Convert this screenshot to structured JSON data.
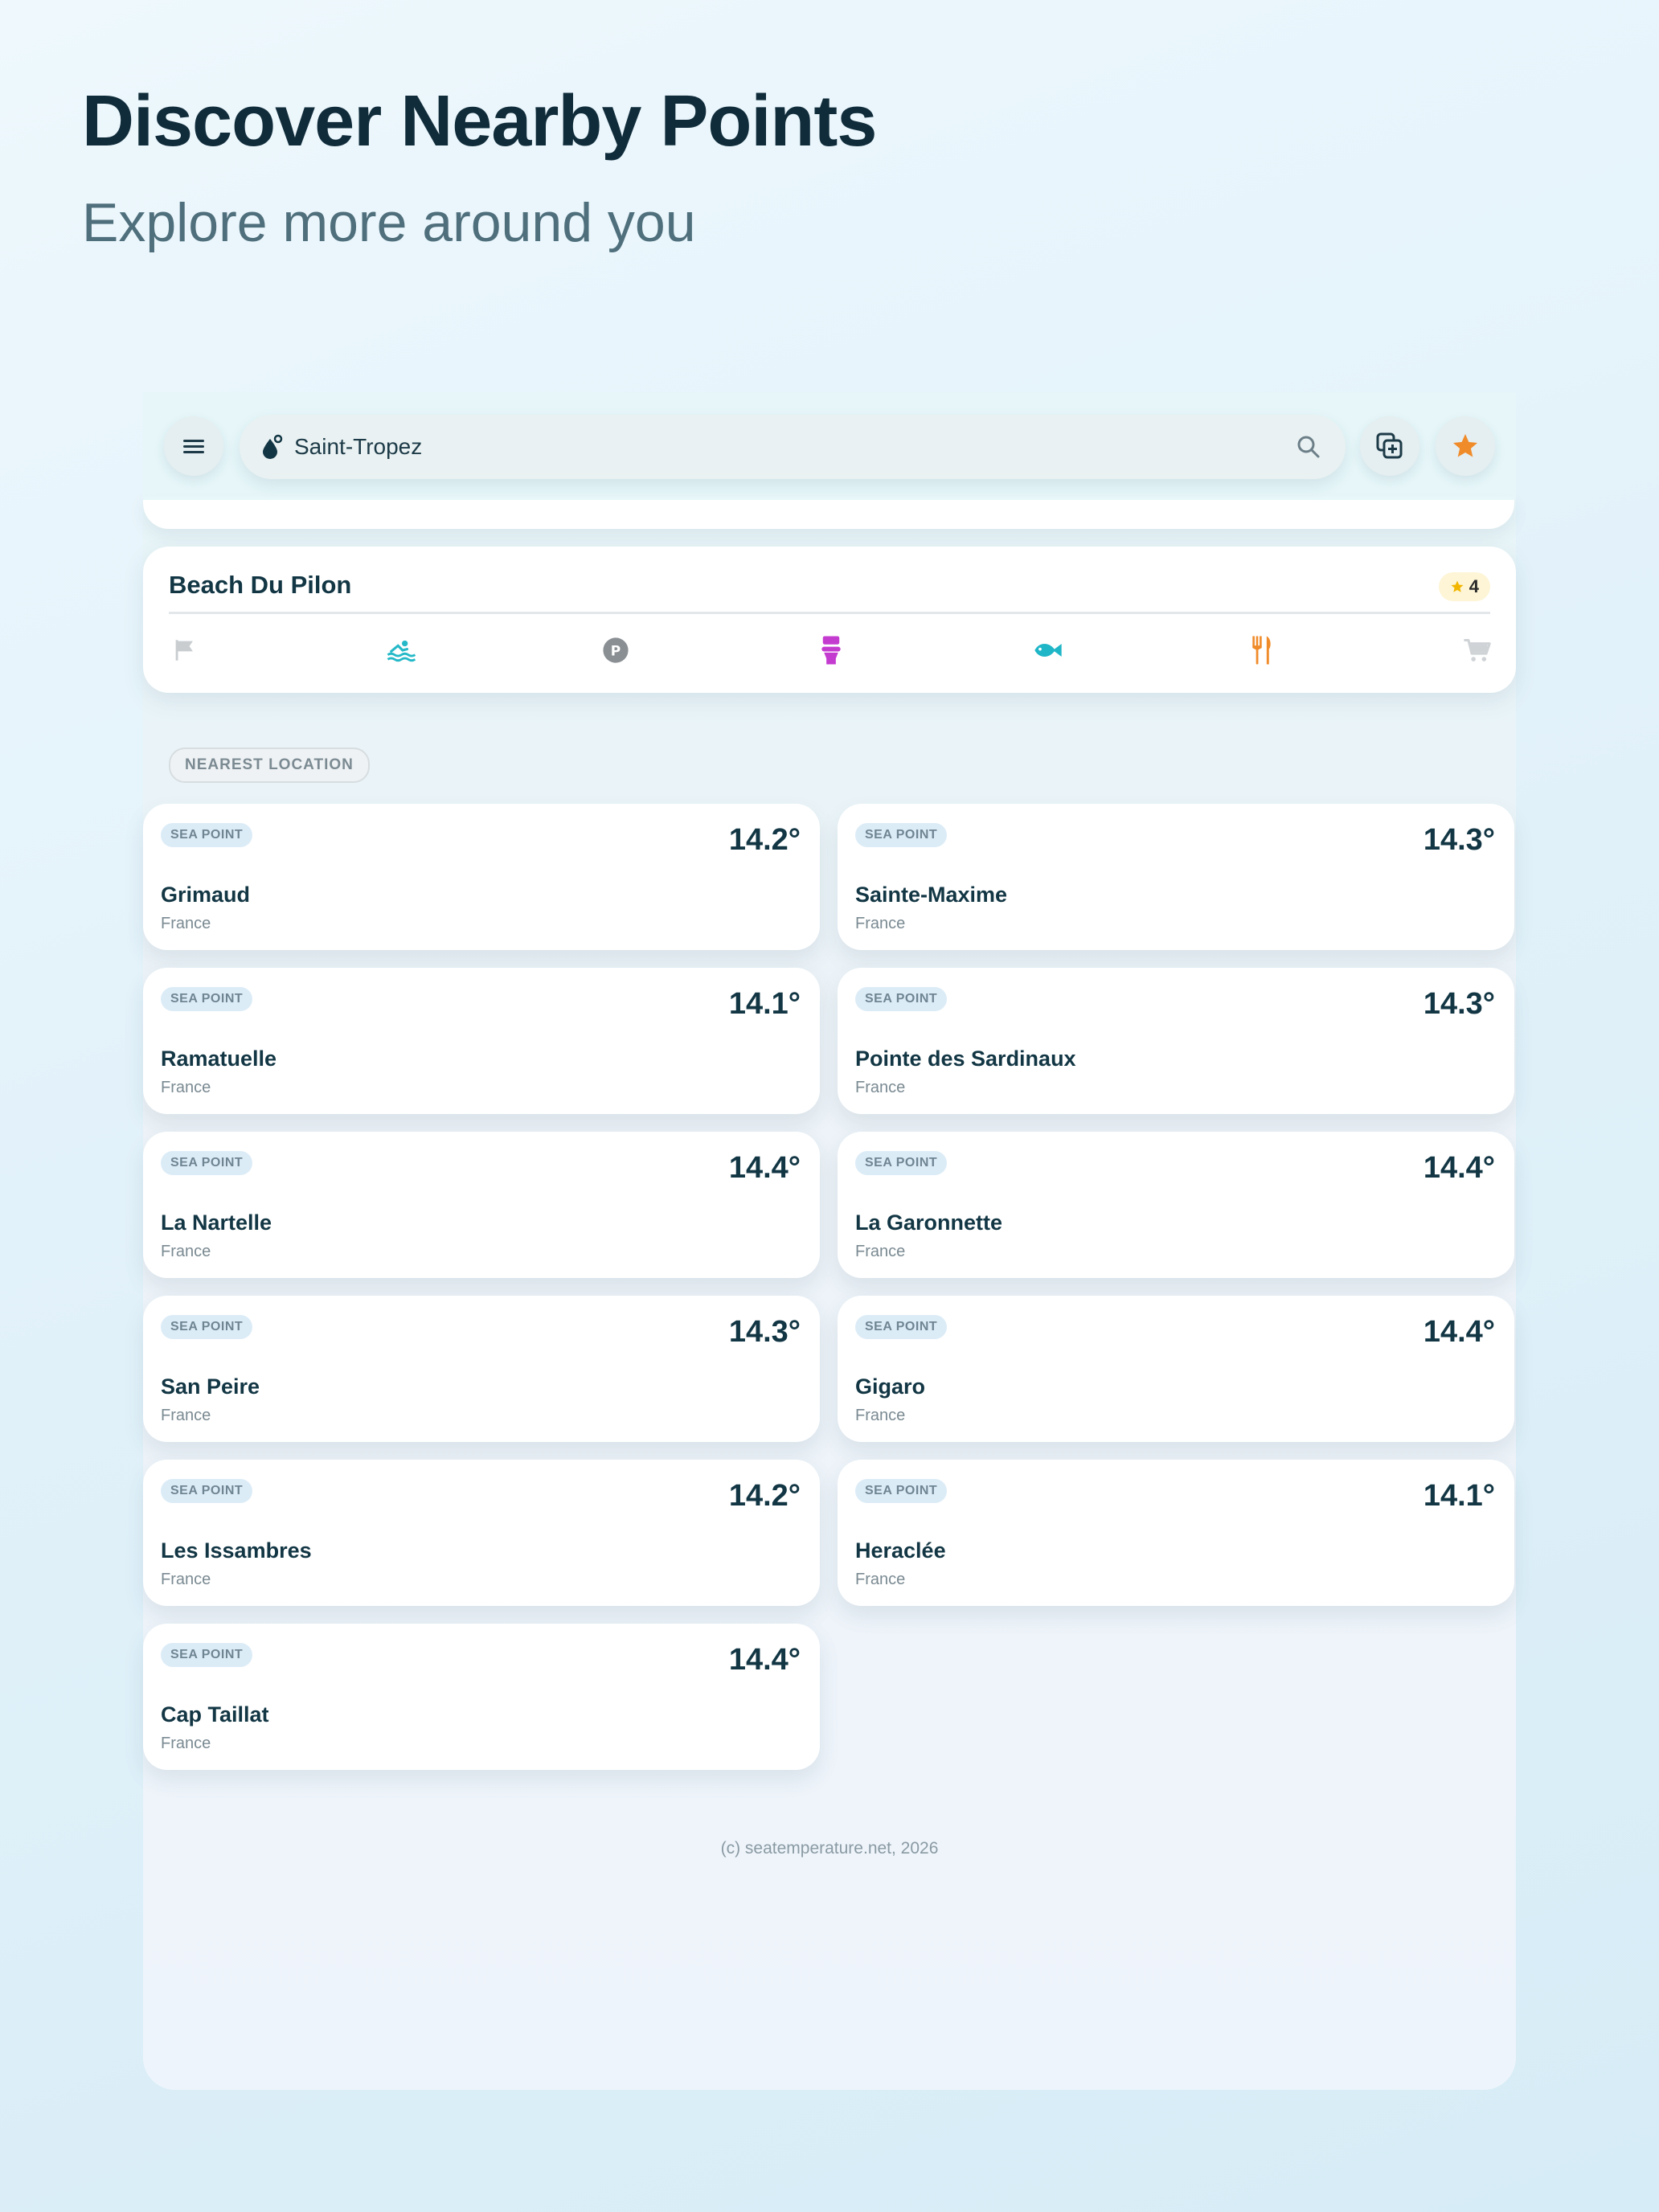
{
  "hero": {
    "title": "Discover Nearby Points",
    "subtitle": "Explore more around you"
  },
  "topbar": {
    "search_value": "Saint-Tropez",
    "icons": [
      "menu-icon",
      "drop-icon",
      "search-icon",
      "add-compare-icon",
      "star-icon"
    ]
  },
  "beach": {
    "name": "Beach Du Pilon",
    "rating": "4",
    "amenities": [
      {
        "name": "flag-icon",
        "color": "#c9cdd0"
      },
      {
        "name": "swim-icon",
        "color": "#25b9c8"
      },
      {
        "name": "parking-icon",
        "color": "#8a8f93"
      },
      {
        "name": "toilet-icon",
        "color": "#c43bd0"
      },
      {
        "name": "fish-icon",
        "color": "#1fb6c7"
      },
      {
        "name": "restaurant-icon",
        "color": "#f08b2a"
      },
      {
        "name": "cart-icon",
        "color": "#cfd3d6"
      }
    ]
  },
  "section": {
    "label": "NEAREST LOCATION"
  },
  "badge_label": "SEA POINT",
  "locations": [
    {
      "name": "Grimaud",
      "country": "France",
      "temp": "14.2°"
    },
    {
      "name": "Sainte-Maxime",
      "country": "France",
      "temp": "14.3°"
    },
    {
      "name": "Ramatuelle",
      "country": "France",
      "temp": "14.1°"
    },
    {
      "name": "Pointe des Sardinaux",
      "country": "France",
      "temp": "14.3°"
    },
    {
      "name": "La Nartelle",
      "country": "France",
      "temp": "14.4°"
    },
    {
      "name": "La Garonnette",
      "country": "France",
      "temp": "14.4°"
    },
    {
      "name": "San Peire",
      "country": "France",
      "temp": "14.3°"
    },
    {
      "name": "Gigaro",
      "country": "France",
      "temp": "14.4°"
    },
    {
      "name": "Les Issambres",
      "country": "France",
      "temp": "14.2°"
    },
    {
      "name": "Heraclée",
      "country": "France",
      "temp": "14.1°"
    },
    {
      "name": "Cap Taillat",
      "country": "France",
      "temp": "14.4°"
    }
  ],
  "footer": {
    "text": "(c) seatemperature.net, 2026"
  },
  "colors": {
    "accent_orange": "#f08b2a",
    "title": "#102c3a"
  }
}
